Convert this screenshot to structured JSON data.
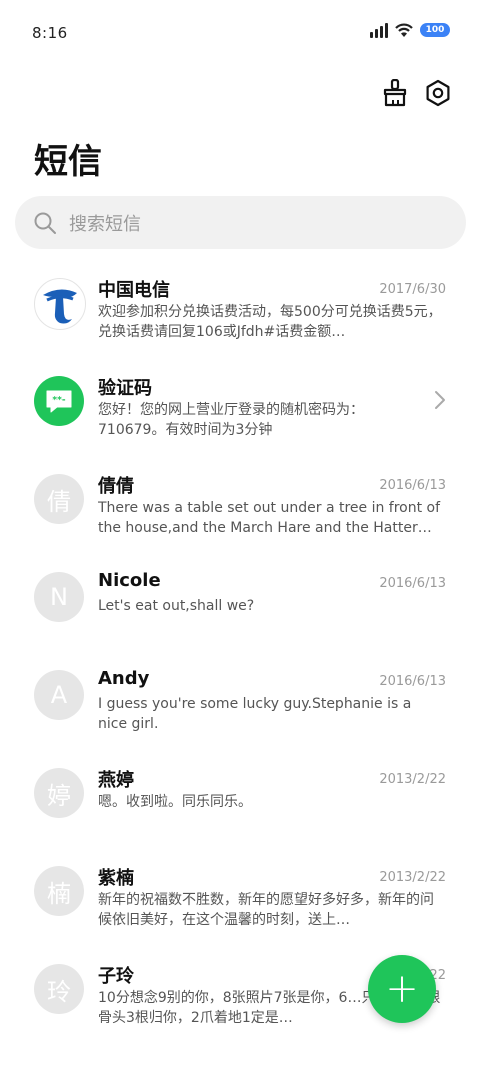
{
  "status_bar": {
    "time": "8:16",
    "battery": "100"
  },
  "header": {
    "title": "短信"
  },
  "search": {
    "placeholder": "搜索短信"
  },
  "messages": [
    {
      "name": "中国电信",
      "date": "2017/6/30",
      "preview": "欢迎参加积分兑换话费活动，每500分可兑换话费5元，兑换话费请回复106或Jfdh#话费金额…"
    },
    {
      "name": "验证码",
      "date": "",
      "preview": "您好！您的网上营业厅登录的随机密码为：710679。有效时间为3分钟"
    },
    {
      "name": "倩倩",
      "avatar": "倩",
      "date": "2016/6/13",
      "preview": "There was a table set out under a tree in front of the house,and the March Hare and the Hatter were…"
    },
    {
      "name": "Nicole",
      "avatar": "N",
      "date": "2016/6/13",
      "preview": "Let's eat out,shall we?"
    },
    {
      "name": "Andy",
      "avatar": "A",
      "date": "2016/6/13",
      "preview": "I guess you're some lucky guy.Stephanie is a nice girl."
    },
    {
      "name": "燕婷",
      "avatar": "婷",
      "date": "2013/2/22",
      "preview": "嗯。收到啦。同乐同乐。"
    },
    {
      "name": "紫楠",
      "avatar": "楠",
      "date": "2013/2/22",
      "preview": "新年的祝福数不胜数，新年的愿望好多好多，新年的问候依旧美好，在这个温馨的时刻，送上…"
    },
    {
      "name": "子玲",
      "avatar": "玲",
      "date": "2013/2/22",
      "preview": "10分想念9别的你，8张照片7张是你，6…只像你，4根骨头3根归你，2爪着地1定是…"
    }
  ],
  "fab": {
    "label": "+"
  },
  "colors": {
    "accent": "#1fc55a",
    "telecom_blue": "#1b5fb8",
    "battery": "#3b82f6"
  }
}
